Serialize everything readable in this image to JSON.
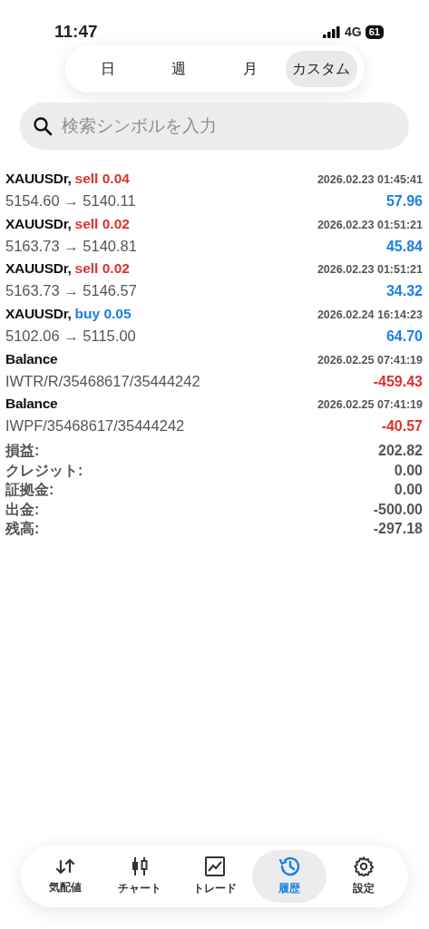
{
  "status_bar": {
    "time": "11:47",
    "network": "4G",
    "battery": "61"
  },
  "period_tabs": [
    {
      "label": "日",
      "selected": false
    },
    {
      "label": "週",
      "selected": false
    },
    {
      "label": "月",
      "selected": false
    },
    {
      "label": "カスタム",
      "selected": true
    }
  ],
  "search": {
    "placeholder": "検索シンボルを入力"
  },
  "deals": [
    {
      "kind": "trade",
      "symbol": "XAUUSDr,",
      "buy": false,
      "order": "sell 0.04",
      "time": "2026.02.23 01:45:41",
      "detail": "5154.60 → 5140.11",
      "profit": "57.96",
      "loss": false
    },
    {
      "kind": "trade",
      "symbol": "XAUUSDr,",
      "buy": false,
      "order": "sell 0.02",
      "time": "2026.02.23 01:51:21",
      "detail": "5163.73 → 5140.81",
      "profit": "45.84",
      "loss": false
    },
    {
      "kind": "trade",
      "symbol": "XAUUSDr,",
      "buy": false,
      "order": "sell 0.02",
      "time": "2026.02.23 01:51:21",
      "detail": "5163.73 → 5146.57",
      "profit": "34.32",
      "loss": false
    },
    {
      "kind": "trade",
      "symbol": "XAUUSDr,",
      "buy": true,
      "order": "buy 0.05",
      "time": "2026.02.24 16:14:23",
      "detail": "5102.06 → 5115.00",
      "profit": "64.70",
      "loss": false
    },
    {
      "kind": "balance",
      "symbol": "Balance",
      "time": "2026.02.25 07:41:19",
      "detail": "IWTR/R/35468617/35444242",
      "profit": "-459.43",
      "loss": true
    },
    {
      "kind": "balance",
      "symbol": "Balance",
      "time": "2026.02.25 07:41:19",
      "detail": "IWPF/35468617/35444242",
      "profit": "-40.57",
      "loss": true
    }
  ],
  "summary": [
    {
      "label": "損益:",
      "value": "202.82"
    },
    {
      "label": "クレジット:",
      "value": "0.00"
    },
    {
      "label": "証拠金:",
      "value": "0.00"
    },
    {
      "label": "出金:",
      "value": "-500.00"
    },
    {
      "label": "残高:",
      "value": "-297.18"
    }
  ],
  "tab_bar": [
    {
      "kind": "quotes",
      "label": "気配値",
      "selected": false
    },
    {
      "kind": "chart",
      "label": "チャート",
      "selected": false
    },
    {
      "kind": "trade",
      "label": "トレード",
      "selected": false
    },
    {
      "kind": "history",
      "label": "履歴",
      "selected": true
    },
    {
      "kind": "settings",
      "label": "設定",
      "selected": false
    }
  ]
}
